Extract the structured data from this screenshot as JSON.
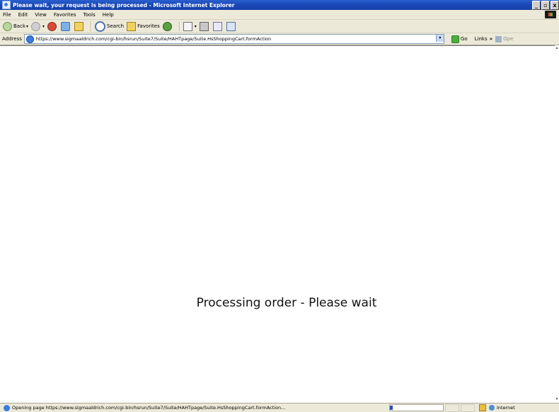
{
  "window": {
    "title": "Please wait, your request is being processed - Microsoft Internet Explorer",
    "controls": {
      "minimize": "_",
      "maximize": "▫",
      "close": "x"
    }
  },
  "menu": {
    "items": [
      "File",
      "Edit",
      "View",
      "Favorites",
      "Tools",
      "Help"
    ]
  },
  "toolbar": {
    "back_label": "Back",
    "search_label": "Search",
    "favorites_label": "Favorites"
  },
  "address": {
    "label": "Address",
    "url": "https://www.sigmaaldrich.com/cgi-bin/hsrun/Suite7/Suite/HAHTpage/Suite.HsShoppingCart.formAction",
    "go_label": "Go",
    "links_label": "Links",
    "links_overflow": "»",
    "links_tail": "Ope"
  },
  "page": {
    "message": "Processing order - Please wait"
  },
  "status": {
    "text": "Opening page https://www.sigmaaldrich.com/cgi-bin/hsrun/Suite7/Suite/HAHTpage/Suite.HsShoppingCart.formAction...",
    "progress": 0.05,
    "zone": "Internet"
  },
  "icons": {
    "page": "ie-page-icon",
    "status": "ie-status-icon",
    "lock": "lock-icon",
    "zone": "globe-icon"
  }
}
